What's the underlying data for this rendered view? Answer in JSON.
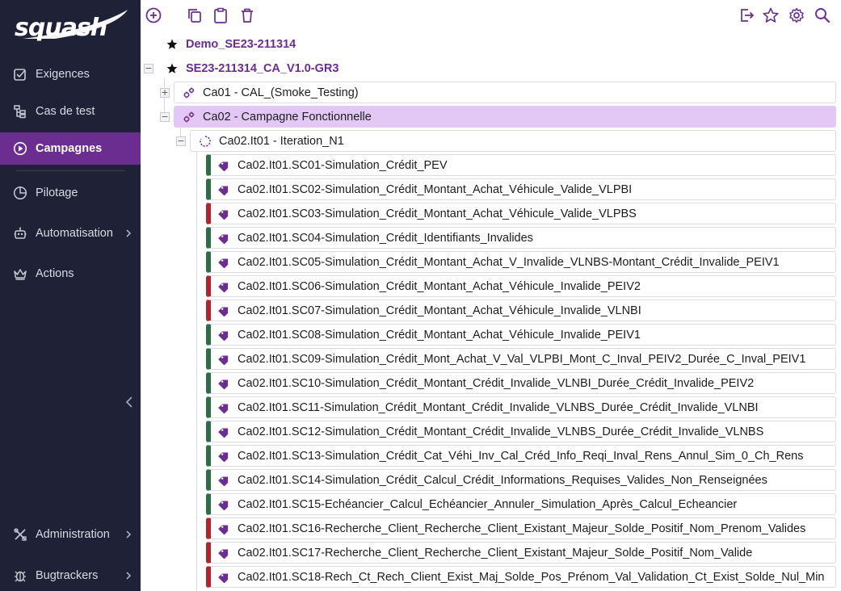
{
  "app": {
    "logo_text": "squash"
  },
  "colors": {
    "sidebar_bg": "#1f2136",
    "accent": "#6b2d8f",
    "selected_bg": "#e3c8f5",
    "status_green": "#2e6b47",
    "status_red": "#b3232d"
  },
  "sidebar": {
    "items": [
      {
        "label": "Exigences",
        "icon": "checkbox-icon"
      },
      {
        "label": "Cas de test",
        "icon": "tree-structure-icon"
      },
      {
        "label": "Campagnes",
        "icon": "play-circle-icon",
        "active": true
      },
      {
        "label": "Pilotage",
        "icon": "pie-chart-icon"
      },
      {
        "label": "Automatisation",
        "icon": "robot-icon",
        "has_submenu": true
      },
      {
        "label": "Actions",
        "icon": "crown-icon"
      },
      {
        "label": "Administration",
        "icon": "tools-icon",
        "has_submenu": true
      },
      {
        "label": "Bugtrackers",
        "icon": "bug-icon",
        "has_submenu": true
      }
    ]
  },
  "toolbar": {
    "left": [
      "add-circle-icon",
      "copy-icon",
      "paste-clipboard-icon",
      "trash-icon"
    ],
    "right": [
      "export-icon",
      "star-outline-icon",
      "gear-icon",
      "search-icon"
    ]
  },
  "tree": {
    "projects": [
      {
        "label": "Demo_SE23-211314"
      },
      {
        "label": "SE23-211314_CA_V1.0-GR3"
      }
    ],
    "campaigns": [
      {
        "label": "Ca01 - CAL_(Smoke_Testing)"
      },
      {
        "label": "Ca02 - Campagne Fonctionnelle"
      }
    ],
    "iteration": {
      "label": "Ca02.It01 - Iteration_N1"
    },
    "suites": [
      {
        "label": "Ca02.It01.SC01-Simulation_Crédit_PEV",
        "status": "green"
      },
      {
        "label": "Ca02.It01.SC02-Simulation_Crédit_Montant_Achat_Véhicule_Valide_VLPBI",
        "status": "green"
      },
      {
        "label": "Ca02.It01.SC03-Simulation_Crédit_Montant_Achat_Véhicule_Valide_VLPBS",
        "status": "red"
      },
      {
        "label": "Ca02.It01.SC04-Simulation_Crédit_Identifiants_Invalides",
        "status": "green"
      },
      {
        "label": "Ca02.It01.SC05-Simulation_Crédit_Montant_Achat_V_Invalide_VLNBS-Montant_Crédit_Invalide_PEIV1",
        "status": "green"
      },
      {
        "label": "Ca02.It01.SC06-Simulation_Crédit_Montant_Achat_Véhicule_Invalide_PEIV2",
        "status": "red"
      },
      {
        "label": "Ca02.It01.SC07-Simulation_Crédit_Montant_Achat_Véhicule_Invalide_VLNBI",
        "status": "red"
      },
      {
        "label": "Ca02.It01.SC08-Simulation_Crédit_Montant_Achat_Véhicule_Invalide_PEIV1",
        "status": "green"
      },
      {
        "label": "Ca02.It01.SC09-Simulation_Crédit_Mont_Achat_V_Val_VLPBI_Mont_C_Inval_PEIV2_Durée_C_Inval_PEIV1",
        "status": "green"
      },
      {
        "label": "Ca02.It01.SC10-Simulation_Crédit_Montant_Crédit_Invalide_VLNBI_Durée_Crédit_Invalide_PEIV2",
        "status": "green"
      },
      {
        "label": "Ca02.It01.SC11-Simulation_Crédit_Montant_Crédit_Invalide_VLNBS_Durée_Crédit_Invalide_VLNBI",
        "status": "green"
      },
      {
        "label": "Ca02.It01.SC12-Simulation_Crédit_Montant_Crédit_Invalide_VLNBS_Durée_Crédit_Invalide_VLNBS",
        "status": "green"
      },
      {
        "label": "Ca02.It01.SC13-Simulation_Crédit_Cat_Véhi_Inv_Cal_Créd_Info_Reqi_Inval_Rens_Annul_Sim_0_Ch_Rens",
        "status": "green"
      },
      {
        "label": "Ca02.It01.SC14-Simulation_Crédit_Calcul_Crédit_Informations_Requises_Valides_Non_Renseignées",
        "status": "green"
      },
      {
        "label": "Ca02.It01.SC15-Echéancier_Calcul_Echéancier_Annuler_Simulation_Après_Calcul_Echeancier",
        "status": "green"
      },
      {
        "label": "Ca02.It01.SC16-Recherche_Client_Recherche_Client_Existant_Majeur_Solde_Positif_Nom_Prenom_Valides",
        "status": "red"
      },
      {
        "label": "Ca02.It01.SC17-Recherche_Client_Recherche_Client_Existant_Majeur_Solde_Positif_Nom_Valide",
        "status": "red"
      },
      {
        "label": "Ca02.It01.SC18-Rech_Ct_Rech_Client_Exist_Maj_Solde_Pos_Prénom_Val_Validation_Ct_Exist_Solde_Nul_Min",
        "status": "red"
      }
    ]
  }
}
